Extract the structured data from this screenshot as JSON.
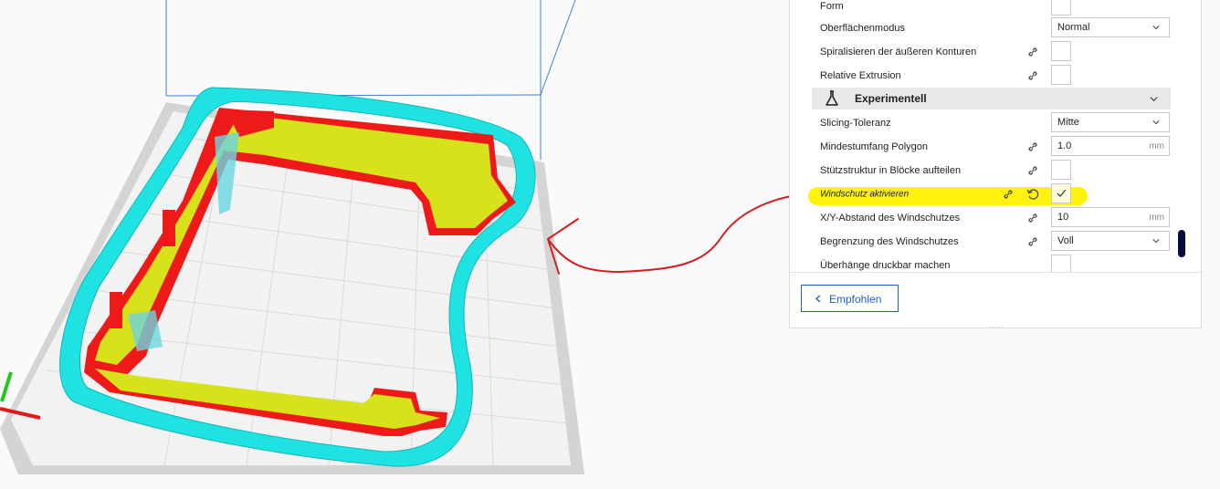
{
  "colors": {
    "accent": "#1f5fbf",
    "highlight": "#fff200",
    "annotation_arrow": "#d21e1e",
    "model_red": "#ee1a1a",
    "model_yellow": "#d8e21a",
    "shield_cyan": "#1ee5e5",
    "build_plate": "#d9d9d9"
  },
  "settings": {
    "rows": [
      {
        "label": "Form",
        "control": "checkbox"
      },
      {
        "label": "Oberflächenmodus",
        "control": "select",
        "value": "Normal"
      },
      {
        "label": "Spiralisieren der äußeren Konturen",
        "control": "checkbox",
        "icon": "link-icon"
      },
      {
        "label": "Relative Extrusion",
        "control": "checkbox",
        "icon": "link-icon"
      }
    ],
    "category": {
      "title": "Experimentell",
      "icon": "flask-icon"
    },
    "experimental_rows": [
      {
        "label": "Slicing-Toleranz",
        "control": "select",
        "value": "Mitte"
      },
      {
        "label": "Mindestumfang Polygon",
        "control": "input",
        "value": "1.0",
        "unit": "mm",
        "icon": "link-icon"
      },
      {
        "label": "Stützstruktur in Blöcke aufteilen",
        "control": "checkbox",
        "icon": "link-icon"
      },
      {
        "label": "Windschutz aktivieren",
        "control": "checkbox",
        "checked": true,
        "icon": "link-icon",
        "reset_icon": "reset-icon"
      },
      {
        "label": "X/Y-Abstand des Windschutzes",
        "control": "input",
        "value": "10",
        "unit": "mm",
        "icon": "link-icon"
      },
      {
        "label": "Begrenzung des Windschutzes",
        "control": "select",
        "value": "Voll",
        "icon": "link-icon"
      },
      {
        "label": "Überhänge druckbar machen",
        "control": "checkbox"
      }
    ]
  },
  "footer": {
    "recommended_label": "Empfohlen",
    "grip": "....."
  }
}
